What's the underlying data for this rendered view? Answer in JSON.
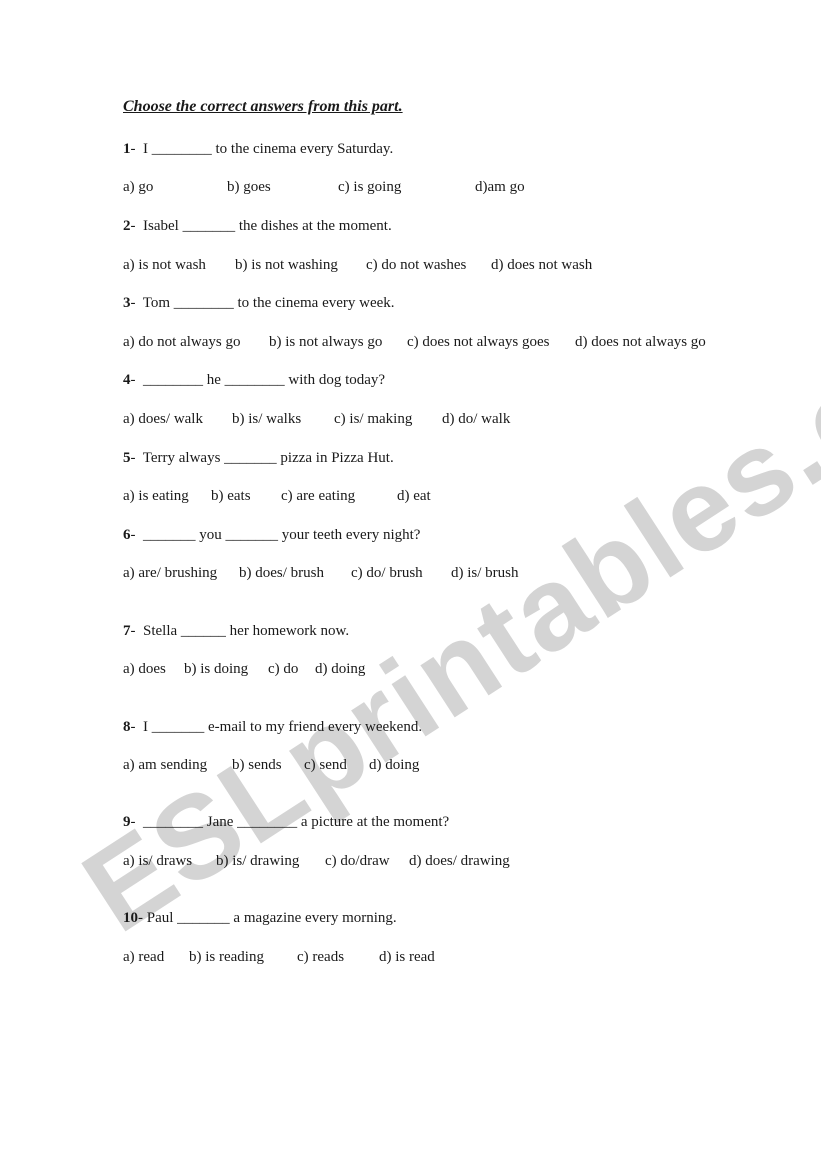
{
  "watermark": "ESLprintables.com",
  "title": "Choose the correct answers from this part.",
  "questions": [
    {
      "num": "1",
      "sep": "-  ",
      "text": "I ________ to the cinema every Saturday.",
      "options": [
        "a) go",
        "b) goes",
        "c) is going",
        "d)am go"
      ]
    },
    {
      "num": "2",
      "sep": "-  ",
      "text": "Isabel _______ the dishes at the moment.",
      "options": [
        "a) is not wash",
        "b) is not washing",
        "c) do not washes",
        "d) does not wash"
      ]
    },
    {
      "num": "3",
      "sep": "-  ",
      "text": "Tom ________ to the cinema every week.",
      "options": [
        "a) do not always go",
        "b) is not always go",
        "c) does not always goes",
        "d) does not always go"
      ]
    },
    {
      "num": "4",
      "sep": "-  ",
      "text": "________ he ________ with dog today?",
      "options": [
        "a) does/ walk",
        "b) is/ walks",
        "c) is/ making",
        "d) do/ walk"
      ]
    },
    {
      "num": "5",
      "sep": "-  ",
      "text": "Terry always _______ pizza in Pizza Hut.",
      "options": [
        "a) is eating",
        "b) eats",
        "c) are eating",
        "d) eat"
      ]
    },
    {
      "num": "6",
      "sep": "-  ",
      "text": "_______ you _______ your teeth every night?",
      "options": [
        "a) are/ brushing",
        "b) does/ brush",
        "c) do/ brush",
        "d) is/ brush"
      ]
    },
    {
      "num": "7",
      "sep": "-  ",
      "text": "Stella ______ her homework now.",
      "options": [
        "a) does",
        "b) is doing",
        "c) do",
        "d) doing"
      ]
    },
    {
      "num": "8",
      "sep": "-  ",
      "text": "I _______ e-mail to my friend every weekend.",
      "options": [
        "a) am sending",
        "b) sends",
        "c) send",
        "d) doing"
      ]
    },
    {
      "num": "9",
      "sep": "-  ",
      "text": "________ Jane ________ a picture at the moment?",
      "options": [
        "a) is/ draws",
        "b) is/ drawing",
        "c) do/draw",
        "d) does/ drawing"
      ]
    },
    {
      "num": "10",
      "sep": "- ",
      "text": "Paul _______ a magazine every morning.",
      "options": [
        "a) read",
        "b) is reading",
        "c) reads",
        "d) is read"
      ]
    }
  ]
}
